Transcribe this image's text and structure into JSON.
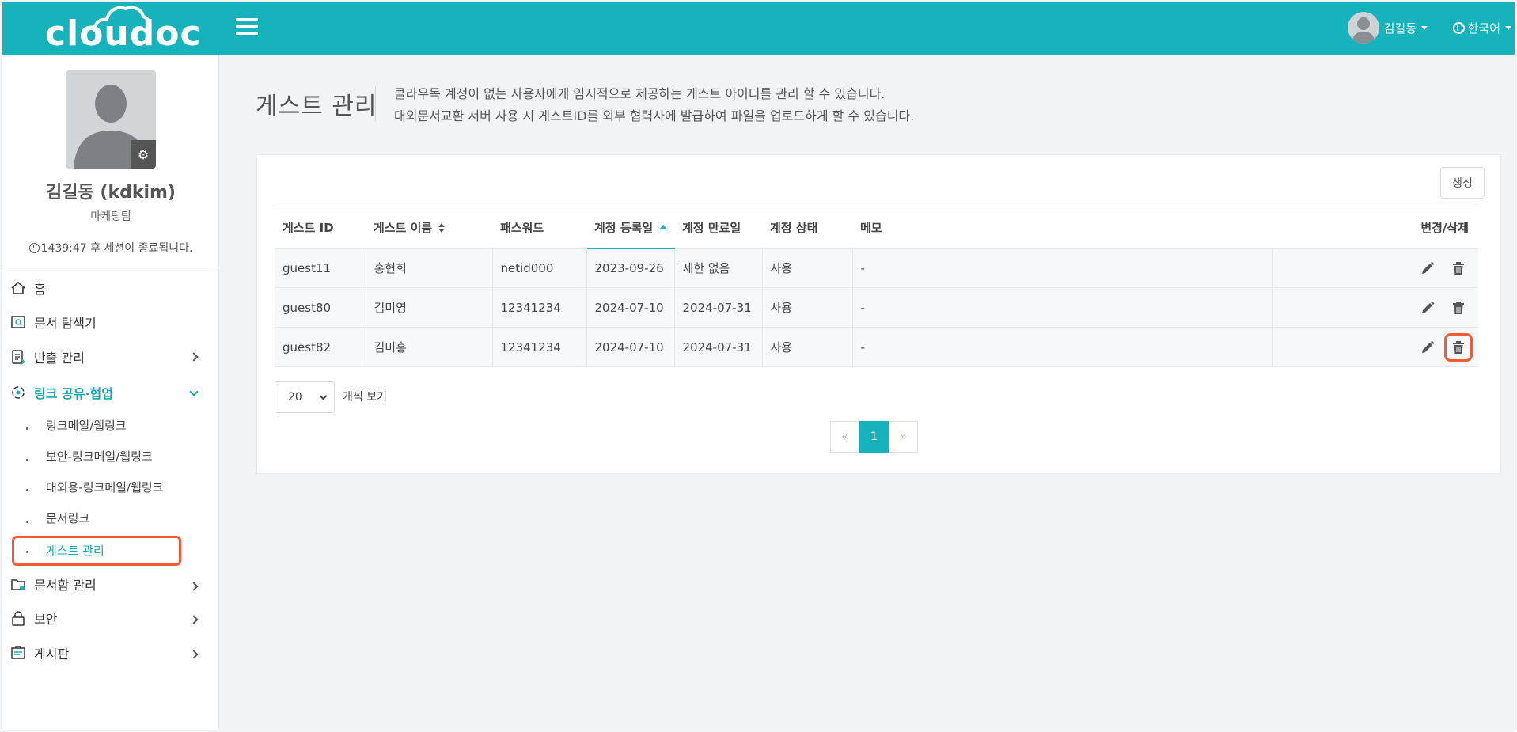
{
  "header": {
    "logo": "cloudoc",
    "user_name": "김길동",
    "language": "한국어"
  },
  "profile": {
    "name": "김길동 (kdkim)",
    "department": "마케팅팀",
    "session_text": "1439:47 후 세션이 종료됩니다."
  },
  "sidebar": {
    "items": [
      {
        "label": "홈",
        "icon": "home-icon"
      },
      {
        "label": "문서 탐색기",
        "icon": "document-search-icon"
      },
      {
        "label": "반출 관리",
        "icon": "export-doc-icon"
      },
      {
        "label": "링크 공유·협업",
        "icon": "link-share-icon"
      },
      {
        "label": "문서함 관리",
        "icon": "folder-settings-icon"
      },
      {
        "label": "보안",
        "icon": "lock-icon"
      },
      {
        "label": "게시판",
        "icon": "board-icon"
      }
    ],
    "sub_items": [
      {
        "label": "링크메일/웹링크"
      },
      {
        "label": "보안-링크메일/웹링크"
      },
      {
        "label": "대외용-링크메일/웹링크"
      },
      {
        "label": "문서링크"
      },
      {
        "label": "게스트 관리"
      }
    ]
  },
  "page": {
    "title": "게스트 관리",
    "desc_line1": "클라우독 계정이 없는 사용자에게 임시적으로 제공하는 게스트 아이디를 관리 할 수 있습니다.",
    "desc_line2": "대외문서교환 서버 사용 시 게스트ID를 외부 협력사에 발급하여 파일을 업로드하게 할 수 있습니다.",
    "create_label": "생성"
  },
  "table": {
    "headers": [
      "게스트 ID",
      "게스트 이름",
      "패스워드",
      "계정 등록일",
      "계정 만료일",
      "계정 상태",
      "메모",
      "변경/삭제"
    ],
    "rows": [
      [
        "guest11",
        "홍현희",
        "netid000",
        "2023-09-26",
        "제한 없음",
        "사용",
        "-"
      ],
      [
        "guest80",
        "김미영",
        "12341234",
        "2024-07-10",
        "2024-07-31",
        "사용",
        "-"
      ],
      [
        "guest82",
        "김미홍",
        "12341234",
        "2024-07-10",
        "2024-07-31",
        "사용",
        "-"
      ]
    ]
  },
  "pagination": {
    "page_size": "20",
    "page_size_label": "개씩 보기",
    "prev": "«",
    "current": "1",
    "next": "»"
  },
  "colors": {
    "brand": "#16b3bd",
    "highlight": "#f25a35"
  }
}
